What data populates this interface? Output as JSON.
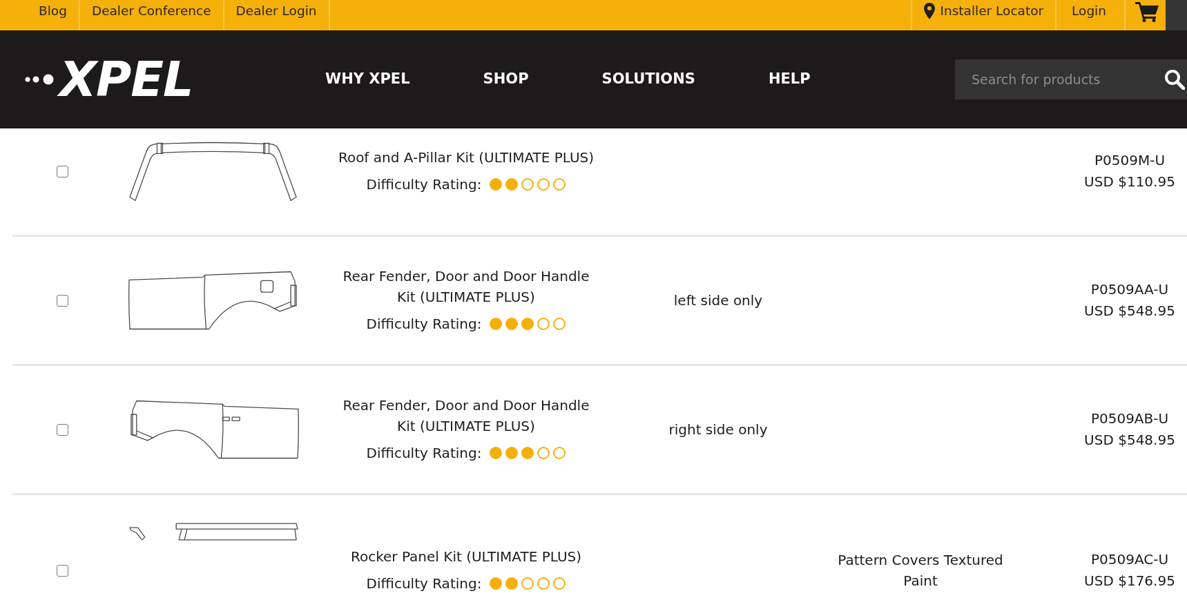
{
  "top_bar": {
    "left_links": [
      "Blog",
      "Dealer Conference",
      "Dealer Login"
    ],
    "installer_locator": "Installer Locator",
    "login": "Login"
  },
  "header": {
    "logo": "XPEL",
    "nav": [
      "WHY XPEL",
      "SHOP",
      "SOLUTIONS",
      "HELP"
    ],
    "search": {
      "placeholder": "Search for products"
    }
  },
  "products": [
    {
      "checked": false,
      "title": "Roof and A-Pillar Kit (ULTIMATE PLUS)",
      "rating_label": "Difficulty Rating:",
      "stars": 2,
      "part_number": "P0509M-U",
      "price": "USD $110.95"
    },
    {
      "checked": false,
      "title": "Rear Fender, Door and Door Handle Kit (ULTIMATE PLUS)",
      "rating_label": "Difficulty Rating:",
      "stars": 3,
      "column_3": "left side only",
      "part_number": "P0509AA-U",
      "price": "USD $548.95"
    },
    {
      "checked": false,
      "title": "Rear Fender, Door and Door Handle Kit (ULTIMATE PLUS)",
      "rating_label": "Difficulty Rating:",
      "stars": 3,
      "column_3": "right side only",
      "part_number": "P0509AB-U",
      "price": "USD $548.95"
    },
    {
      "checked": false,
      "title": "Rocker Panel Kit (ULTIMATE PLUS)",
      "rating_label": "Difficulty Rating:",
      "stars": 2,
      "column_4": "Pattern Covers Textured Paint",
      "part_number": "P0509AC-U",
      "price": "USD $176.95"
    }
  ]
}
